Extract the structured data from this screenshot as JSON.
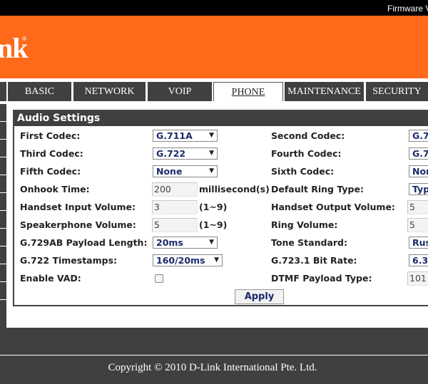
{
  "header": {
    "firmware_label": "Firmware V",
    "logo_text": "nk",
    "logo_reg": "®"
  },
  "nav": {
    "tabs": [
      {
        "label": "BASIC",
        "active": false
      },
      {
        "label": "NETWORK",
        "active": false
      },
      {
        "label": "VOIP",
        "active": false
      },
      {
        "label": "PHONE",
        "active": true
      },
      {
        "label": "MAINTENANCE",
        "active": false
      },
      {
        "label": "SECURITY",
        "active": false
      }
    ]
  },
  "panel": {
    "title": "Audio Settings",
    "rows": [
      {
        "left_label": "First Codec:",
        "left_value": "G.711A",
        "right_label": "Second Codec:",
        "right_value": "G.7"
      },
      {
        "left_label": "Third Codec:",
        "left_value": "G.722",
        "right_label": "Fourth Codec:",
        "right_value": "G.7"
      },
      {
        "left_label": "Fifth Codec:",
        "left_value": "None",
        "right_label": "Sixth Codec:",
        "right_value": "Non"
      },
      {
        "left_label": "Onhook Time:",
        "left_value": "200",
        "left_unit": "millisecond(s)",
        "right_label": "Default Ring Type:",
        "right_value": "Typ"
      },
      {
        "left_label": "Handset Input Volume:",
        "left_value": "3",
        "left_unit": "(1~9)",
        "right_label": "Handset Output Volume:",
        "right_value": "5"
      },
      {
        "left_label": "Speakerphone Volume:",
        "left_value": "5",
        "left_unit": "(1~9)",
        "right_label": "Ring Volume:",
        "right_value": "5"
      },
      {
        "left_label": "G.729AB Payload Length:",
        "left_value": "20ms",
        "right_label": "Tone Standard:",
        "right_value": "Rus"
      },
      {
        "left_label": "G.722 Timestamps:",
        "left_value": "160/20ms",
        "right_label": "G.723.1 Bit Rate:",
        "right_value": "6.3"
      },
      {
        "left_label": "Enable VAD:",
        "left_checked": false,
        "right_label": "DTMF Payload Type:",
        "right_value": "101"
      }
    ],
    "apply_label": "Apply"
  },
  "footer": {
    "copyright": "Copyright © 2010 D-Link International Pte. Ltd."
  },
  "colors": {
    "brand_orange": "#ff6a1a",
    "dark_gray": "#404040",
    "value_blue": "#1a2a6c"
  }
}
